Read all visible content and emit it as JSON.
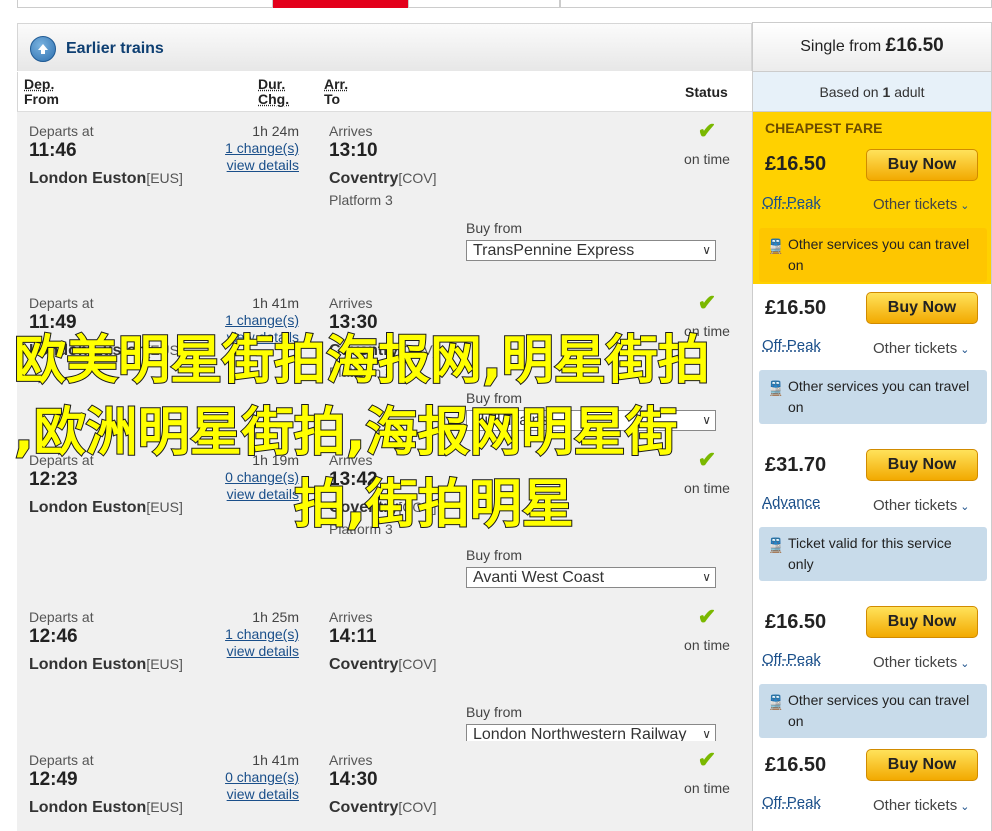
{
  "header": {
    "earlier_label": "Earlier trains",
    "single_from_prefix": "Single from",
    "single_from_price": "£16.50",
    "based_on_prefix": "Based on",
    "based_on_count": "1",
    "based_on_suffix": "adult"
  },
  "columns": {
    "dep_line1": "Dep.",
    "dep_line2": "From",
    "dur_line1": "Dur.",
    "dur_line2": "Chg.",
    "arr_line1": "Arr.",
    "arr_line2": "To",
    "status": "Status"
  },
  "journeys": [
    {
      "departs_label": "Departs at",
      "dep_time": "11:46",
      "from_station": "London Euston",
      "from_code": "[EUS]",
      "duration": "1h 24m",
      "changes": "1 change(s)",
      "details": "view details",
      "arrives_label": "Arrives",
      "arr_time": "13:10",
      "to_station": "Coventry",
      "to_code": "[COV]",
      "platform": "Platform 3",
      "status_icon": "check-icon",
      "status": "on time",
      "buy_from_label": "Buy from",
      "operator": "TransPennine Express",
      "fare_header": "CHEAPEST FARE",
      "price": "£16.50",
      "buy_label": "Buy Now",
      "fare_type": "Off-Peak",
      "other_tickets": "Other tickets",
      "note": "Other services you can travel on"
    },
    {
      "departs_label": "Departs at",
      "dep_time": "11:49",
      "from_station": "London Euston",
      "from_code": "[EUS]",
      "duration": "1h 41m",
      "changes": "1 change(s)",
      "details": "view details",
      "arrives_label": "Arrives",
      "arr_time": "13:30",
      "to_station": "Coventry",
      "to_code": "[COV]",
      "platform": "Platform 3",
      "status_icon": "check-icon",
      "status": "on time",
      "buy_from_label": "Buy from",
      "operator": "Hull Trains",
      "price": "£16.50",
      "buy_label": "Buy Now",
      "fare_type": "Off-Peak",
      "other_tickets": "Other tickets",
      "note": "Other services you can travel on"
    },
    {
      "departs_label": "Departs at",
      "dep_time": "12:23",
      "from_station": "London Euston",
      "from_code": "[EUS]",
      "duration": "1h 19m",
      "changes": "0 change(s)",
      "details": "view details",
      "arrives_label": "Arrives",
      "arr_time": "13:42",
      "to_station": "Coventry",
      "to_code": "[COV]",
      "platform": "Platform 3",
      "status_icon": "check-icon",
      "status": "on time",
      "buy_from_label": "Buy from",
      "operator": "Avanti West Coast",
      "price": "£31.70",
      "buy_label": "Buy Now",
      "fare_type": "Advance",
      "other_tickets": "Other tickets",
      "note": "Ticket valid for this service only"
    },
    {
      "departs_label": "Departs at",
      "dep_time": "12:46",
      "from_station": "London Euston",
      "from_code": "[EUS]",
      "duration": "1h 25m",
      "changes": "1 change(s)",
      "details": "view details",
      "arrives_label": "Arrives",
      "arr_time": "14:11",
      "to_station": "Coventry",
      "to_code": "[COV]",
      "platform": "",
      "status_icon": "check-icon",
      "status": "on time",
      "buy_from_label": "Buy from",
      "operator": "London Northwestern Railway",
      "price": "£16.50",
      "buy_label": "Buy Now",
      "fare_type": "Off-Peak",
      "other_tickets": "Other tickets",
      "note": "Other services you can travel on"
    },
    {
      "departs_label": "Departs at",
      "dep_time": "12:49",
      "from_station": "London Euston",
      "from_code": "[EUS]",
      "duration": "1h 41m",
      "changes": "0 change(s)",
      "details": "view details",
      "arrives_label": "Arrives",
      "arr_time": "14:30",
      "to_station": "Coventry",
      "to_code": "[COV]",
      "platform": "",
      "status_icon": "check-icon",
      "status": "on time",
      "price": "£16.50",
      "buy_label": "Buy Now",
      "fare_type": "Off-Peak",
      "other_tickets": "Other tickets"
    }
  ],
  "watermark": {
    "line1": "欧美明星街拍海报网,明星街拍",
    "line2": ",欧洲明星街拍,海报网明星街",
    "line3": "拍,街拍明星"
  },
  "colors": {
    "accent_red": "#e3001b",
    "cheapest_yellow": "#ffd100",
    "buy_button": "#f2a900",
    "link_blue": "#1a4f8a",
    "tick_green": "#7ab800",
    "watermark_yellow": "#ffff00"
  }
}
